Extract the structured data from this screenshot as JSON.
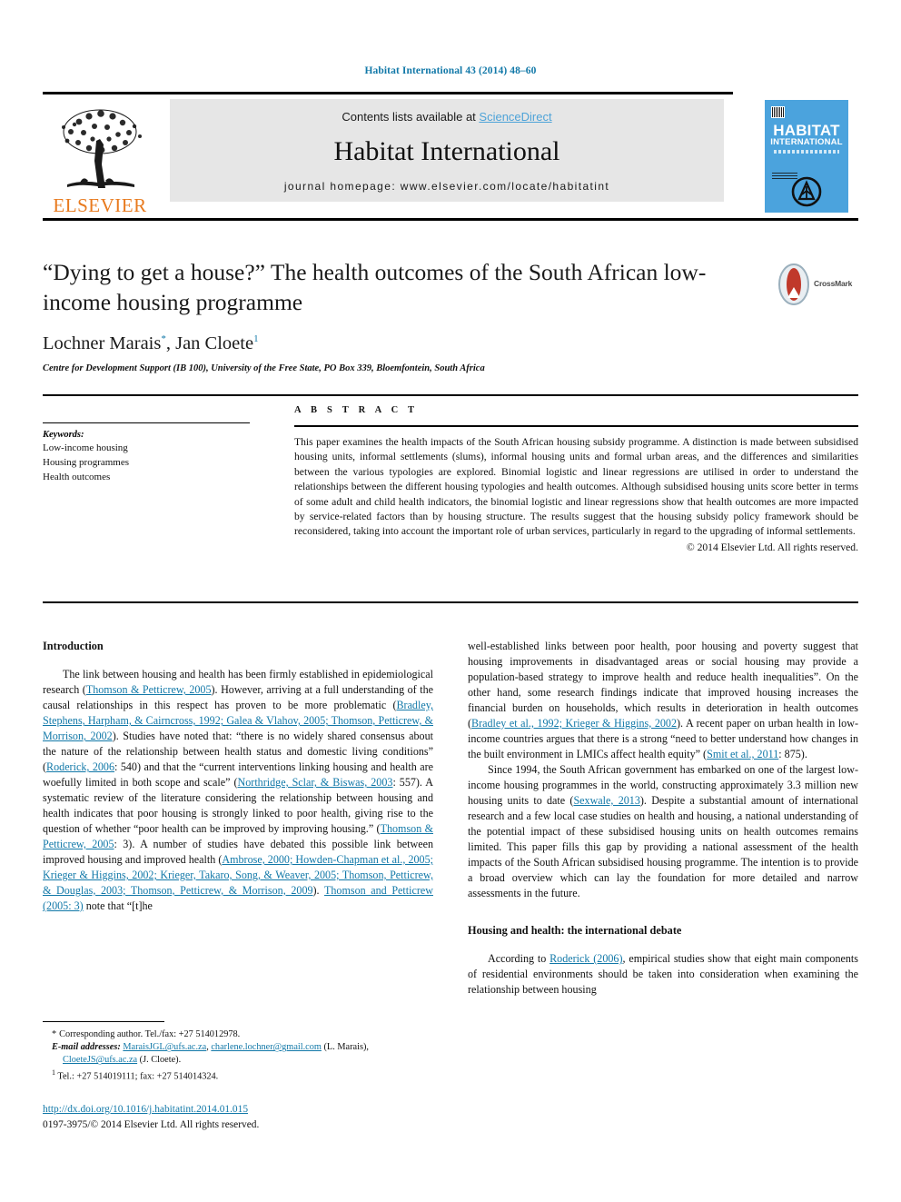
{
  "running_head": "Habitat International 43 (2014) 48–60",
  "masthead": {
    "contents_prefix": "Contents lists available at ",
    "sciencedirect": "ScienceDirect",
    "journal_name": "Habitat International",
    "homepage": "journal homepage: www.elsevier.com/locate/habitatint",
    "publisher": "ELSEVIER",
    "cover": {
      "title_line1": "HABITAT",
      "title_line2": "INTERNATIONAL"
    }
  },
  "article": {
    "title": "“Dying to get a house?” The health outcomes of the South African low-income housing programme",
    "authors_part1": "Lochner Marais",
    "authors_star": "*",
    "authors_part2": ", Jan Cloete",
    "authors_note": "1",
    "affiliation": "Centre for Development Support (IB 100), University of the Free State, PO Box 339, Bloemfontein, South Africa",
    "crossmark_label": "CrossMark"
  },
  "keywords": {
    "heading": "Keywords:",
    "items": [
      "Low-income housing",
      "Housing programmes",
      "Health outcomes"
    ]
  },
  "abstract": {
    "heading": "A B S T R A C T",
    "text": "This paper examines the health impacts of the South African housing subsidy programme. A distinction is made between subsidised housing units, informal settlements (slums), informal housing units and formal urban areas, and the differences and similarities between the various typologies are explored. Binomial logistic and linear regressions are utilised in order to understand the relationships between the different housing typologies and health outcomes. Although subsidised housing units score better in terms of some adult and child health indicators, the binomial logistic and linear regressions show that health outcomes are more impacted by service-related factors than by housing structure. The results suggest that the housing subsidy policy framework should be reconsidered, taking into account the important role of urban services, particularly in regard to the upgrading of informal settlements.",
    "copyright": "© 2014 Elsevier Ltd. All rights reserved."
  },
  "body": {
    "left": {
      "heading": "Introduction",
      "p1_a": "The link between housing and health has been firmly established in epidemiological research (",
      "p1_ref1": "Thomson & Petticrew, 2005",
      "p1_b": "). However, arriving at a full understanding of the causal relationships in this respect has proven to be more problematic (",
      "p1_ref2": "Bradley, Stephens, Harpham, & Cairncross, 1992; Galea & Vlahov, 2005; Thomson, Petticrew, & Morrison, 2002",
      "p1_c": "). Studies have noted that: “there is no widely shared consensus about the nature of the relationship between health status and domestic living conditions” (",
      "p1_ref3": "Roderick, 2006",
      "p1_d": ": 540) and that the “current interventions linking housing and health are woefully limited in both scope and scale” (",
      "p1_ref4": "Northridge, Sclar, & Biswas, 2003",
      "p1_e": ": 557). A systematic review of the literature considering the relationship between housing and health indicates that poor housing is strongly linked to poor health, giving rise to the question of whether “poor health can be improved by improving housing.” (",
      "p1_ref5": "Thomson & Petticrew, 2005",
      "p1_f": ": 3). A number of studies have debated this possible link between improved housing and improved health (",
      "p1_ref6": "Ambrose, 2000; Howden-Chapman et al., 2005; Krieger & Higgins, 2002; Krieger, Takaro, Song, & Weaver, 2005; Thomson, Petticrew, & Douglas, 2003; Thomson, Petticrew, & Morrison, 2009",
      "p1_g": "). ",
      "p1_ref7": "Thomson and Petticrew (2005: 3)",
      "p1_h": " note that “[t]he"
    },
    "right": {
      "p1_a": "well-established links between poor health, poor housing and poverty suggest that housing improvements in disadvantaged areas or social housing may provide a population-based strategy to improve health and reduce health inequalities”. On the other hand, some research findings indicate that improved housing increases the financial burden on households, which results in deterioration in health outcomes (",
      "p1_ref1": "Bradley et al., 1992; Krieger & Higgins, 2002",
      "p1_b": "). A recent paper on urban health in low-income countries argues that there is a strong “need to better understand how changes in the built environment in LMICs affect health equity” (",
      "p1_ref2": "Smit et al., 2011",
      "p1_c": ": 875).",
      "p2_a": "Since 1994, the South African government has embarked on one of the largest low-income housing programmes in the world, constructing approximately 3.3 million new housing units to date (",
      "p2_ref1": "Sexwale, 2013",
      "p2_b": "). Despite a substantial amount of international research and a few local case studies on health and housing, a national understanding of the potential impact of these subsidised housing units on health outcomes remains limited. This paper fills this gap by providing a national assessment of the health impacts of the South African subsidised housing programme. The intention is to provide a broad overview which can lay the foundation for more detailed and narrow assessments in the future.",
      "heading2": "Housing and health: the international debate",
      "p3_a": "According to ",
      "p3_ref1": "Roderick (2006)",
      "p3_b": ", empirical studies show that eight main components of residential environments should be taken into consideration when examining the relationship between housing"
    }
  },
  "footnotes": {
    "corresponding_marker": "*",
    "corresponding": "Corresponding author. Tel./fax: +27 514012978.",
    "email_label": "E-mail addresses:",
    "email1": "MaraisJGL@ufs.ac.za",
    "email_sep1": ", ",
    "email2": "charlene.lochner@gmail.com",
    "email_name1": " (L. Marais), ",
    "email3": "CloeteJS@ufs.ac.za",
    "email_name2": " (J. Cloete).",
    "tel_marker": "1",
    "tel": "Tel.: +27 514019111; fax: +27 514014324."
  },
  "footer": {
    "doi": "http://dx.doi.org/10.1016/j.habitatint.2014.01.015",
    "issn": "0197-3975/© 2014 Elsevier Ltd. All rights reserved."
  },
  "colors": {
    "link_blue": "#1178a8",
    "sciencedirect_blue": "#4ea3d8",
    "elsevier_orange": "#e87a1e",
    "cover_blue": "#4ba3dd",
    "panel_gray": "#e6e6e6"
  }
}
